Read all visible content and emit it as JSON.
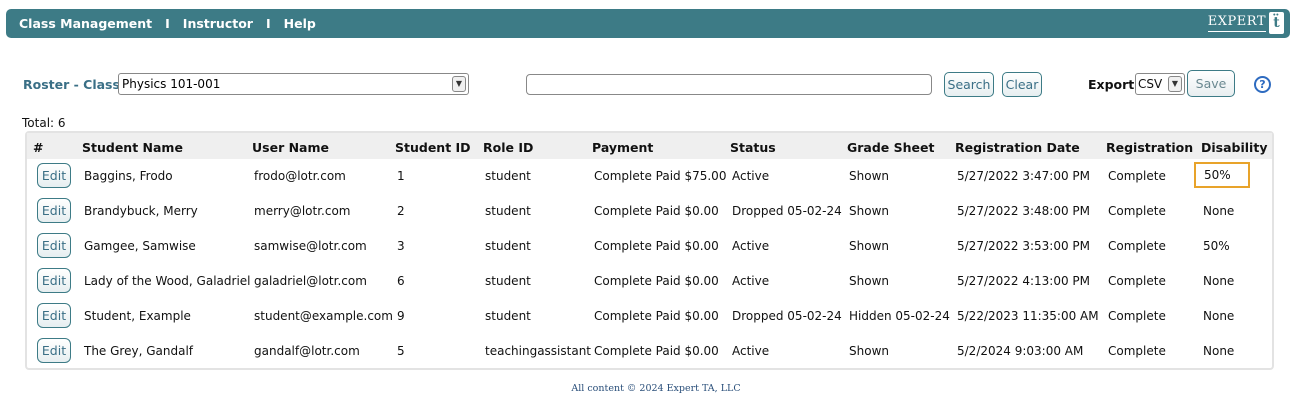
{
  "nav": {
    "items": [
      "Class Management",
      "Instructor",
      "Help"
    ],
    "separator": "I",
    "brand": "EXPERT",
    "brand_mark": "ta"
  },
  "roster": {
    "label": "Roster - Class:",
    "class_value": "Physics 101-001"
  },
  "search": {
    "value": "",
    "search_label": "Search",
    "clear_label": "Clear"
  },
  "export": {
    "label": "Export:",
    "format": "CSV",
    "save_label": "Save"
  },
  "help_icon": "question-circle-icon",
  "total": "Total: 6",
  "table": {
    "headers": [
      "#",
      "Student Name",
      "User Name",
      "Student ID",
      "Role ID",
      "Payment",
      "Status",
      "Grade Sheet",
      "Registration Date",
      "Registration",
      "Disability"
    ],
    "edit_label": "Edit",
    "rows": [
      [
        "Baggins, Frodo",
        "frodo@lotr.com",
        "1",
        "student",
        "Complete Paid $75.00",
        "Active",
        "Shown",
        "5/27/2022 3:47:00 PM",
        "Complete",
        "50%"
      ],
      [
        "Brandybuck, Merry",
        "merry@lotr.com",
        "2",
        "student",
        "Complete Paid $0.00",
        "Dropped 05-02-24",
        "Shown",
        "5/27/2022 3:48:00 PM",
        "Complete",
        "None"
      ],
      [
        "Gamgee, Samwise",
        "samwise@lotr.com",
        "3",
        "student",
        "Complete Paid $0.00",
        "Active",
        "Shown",
        "5/27/2022 3:53:00 PM",
        "Complete",
        "50%"
      ],
      [
        "Lady of the Wood, Galadriel",
        "galadriel@lotr.com",
        "6",
        "student",
        "Complete Paid $0.00",
        "Active",
        "Shown",
        "5/27/2022 4:13:00 PM",
        "Complete",
        "None"
      ],
      [
        "Student, Example",
        "student@example.com",
        "9",
        "student",
        "Complete Paid $0.00",
        "Dropped 05-02-24",
        "Hidden 05-02-24",
        "5/22/2023 11:35:00 AM",
        "Complete",
        "None"
      ],
      [
        "The Grey, Gandalf",
        "gandalf@lotr.com",
        "5",
        "teachingassistant",
        "Complete Paid $0.00",
        "Active",
        "Shown",
        "5/2/2024 9:03:00 AM",
        "Complete",
        "None"
      ]
    ],
    "highlighted_cell": {
      "row": 0,
      "column": "Disability",
      "color": "#e8a32a"
    }
  },
  "footer": "All content © 2024 Expert TA, LLC",
  "colors": {
    "nav_bg": "#3d7b86",
    "accent": "#3a6f86",
    "highlight": "#e8a32a"
  }
}
